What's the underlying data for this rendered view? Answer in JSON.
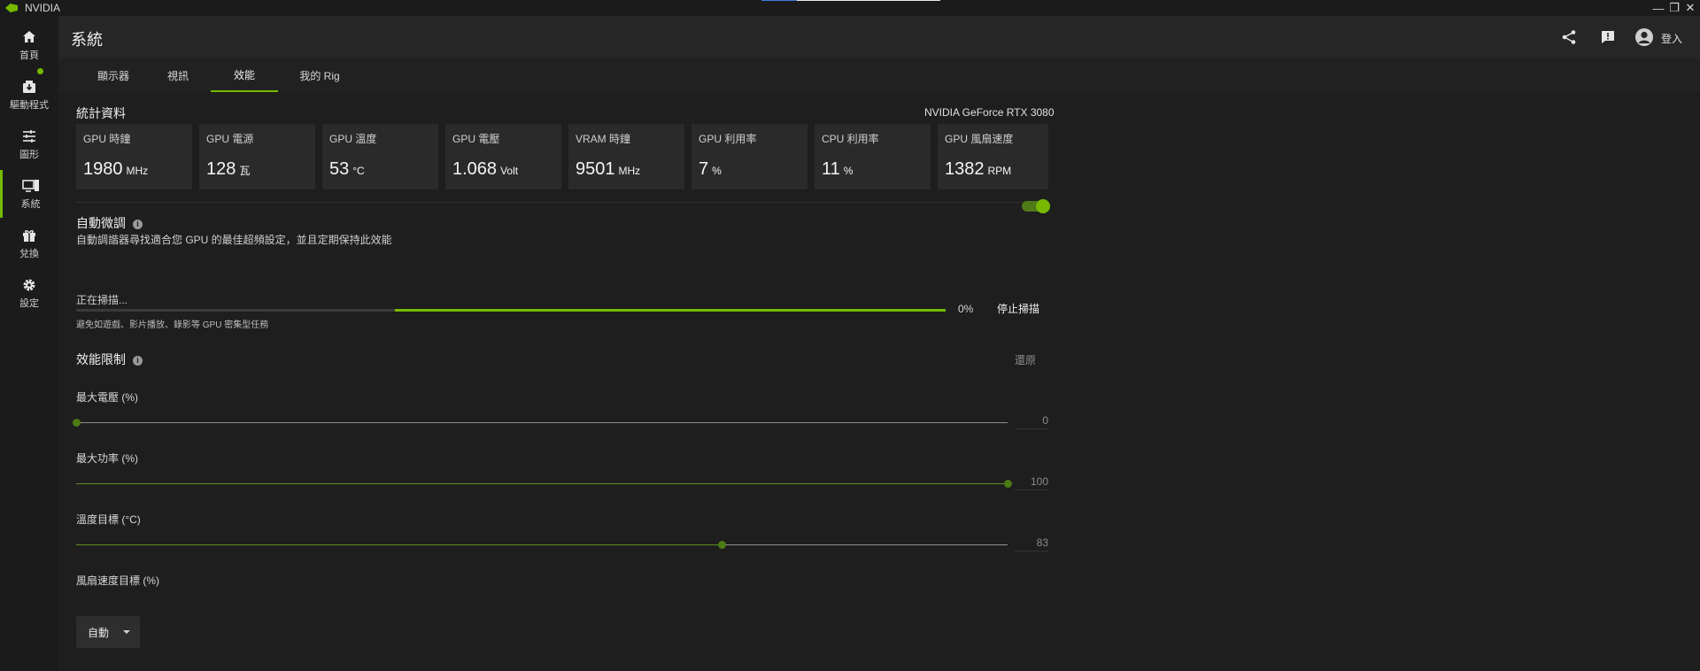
{
  "app": {
    "name": "NVIDIA"
  },
  "window": {
    "minimize": "—",
    "restore": "❐",
    "close": "✕"
  },
  "sidebar": {
    "items": [
      {
        "label": "首頁",
        "icon": "home-icon"
      },
      {
        "label": "驅動程式",
        "icon": "driver-icon",
        "badge": true
      },
      {
        "label": "圖形",
        "icon": "sliders-icon"
      },
      {
        "label": "系統",
        "icon": "system-icon",
        "active": true
      },
      {
        "label": "兌換",
        "icon": "gift-icon"
      },
      {
        "label": "設定",
        "icon": "gear-icon"
      }
    ]
  },
  "header": {
    "title": "系統",
    "login_label": "登入"
  },
  "tabs": [
    {
      "label": "顯示器"
    },
    {
      "label": "視訊"
    },
    {
      "label": "效能",
      "active": true
    },
    {
      "label": "我的 Rig"
    }
  ],
  "stats": {
    "title": "統計資料",
    "gpu_name": "NVIDIA GeForce RTX 3080",
    "cards": [
      {
        "label": "GPU 時鐘",
        "value": "1980",
        "unit": "MHz"
      },
      {
        "label": "GPU 電源",
        "value": "128",
        "unit": "瓦"
      },
      {
        "label": "GPU 溫度",
        "value": "53",
        "unit": "°C"
      },
      {
        "label": "GPU 電壓",
        "value": "1.068",
        "unit": "Volt"
      },
      {
        "label": "VRAM 時鐘",
        "value": "9501",
        "unit": "MHz"
      },
      {
        "label": "GPU 利用率",
        "value": "7",
        "unit": "%"
      },
      {
        "label": "CPU 利用率",
        "value": "11",
        "unit": "%"
      },
      {
        "label": "GPU 風扇速度",
        "value": "1382",
        "unit": "RPM"
      }
    ]
  },
  "auto_tune": {
    "title": "自動微調",
    "description": "自動調諧器尋找適合您 GPU 的最佳超頻設定，並且定期保持此效能",
    "enabled": true,
    "scan_label": "正在掃描...",
    "progress_text": "0%",
    "progress_fraction": 0.0,
    "stop_button": "停止掃描",
    "hint": "避免如遊戲、影片播放、錄影等 GPU 密集型任務"
  },
  "performance_limits": {
    "title": "效能限制",
    "restore_label": "還原",
    "sliders": [
      {
        "label": "最大電壓 (%)",
        "value": "0",
        "fraction": 0.0
      },
      {
        "label": "最大功率 (%)",
        "value": "100",
        "fraction": 1.0
      },
      {
        "label": "溫度目標 (°C)",
        "value": "83",
        "fraction": 0.695
      }
    ],
    "fan": {
      "label": "風扇速度目標 (%)",
      "selected": "自動"
    }
  },
  "colors": {
    "accent": "#76b900",
    "background": "#1b1b1b",
    "card": "#2a2a2a"
  }
}
